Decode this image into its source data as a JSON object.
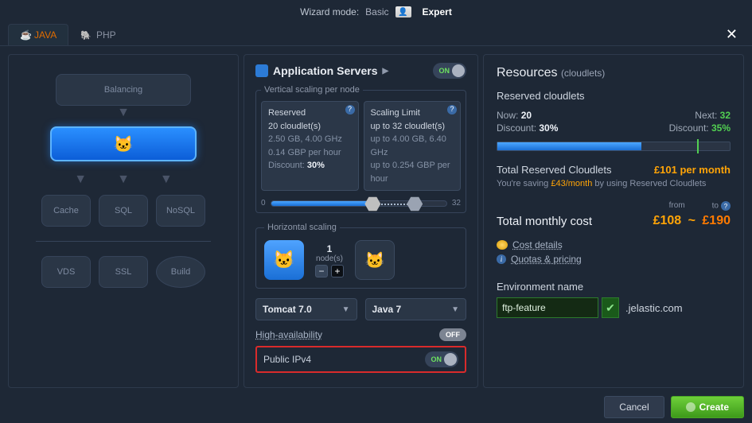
{
  "mode": {
    "label": "Wizard mode:",
    "basic": "Basic",
    "expert": "Expert"
  },
  "tabs": {
    "java": "JAVA",
    "php": "PHP"
  },
  "topology": {
    "balancing": "Balancing",
    "cache": "Cache",
    "sql": "SQL",
    "nosql": "NoSQL",
    "vds": "VDS",
    "ssl": "SSL",
    "build": "Build"
  },
  "appservers": {
    "title": "Application Servers",
    "toggle_icon": "▶",
    "on": "ON",
    "vertical_scaling_legend": "Vertical scaling per node",
    "reserved": {
      "title": "Reserved",
      "subtitle": "20 cloudlet(s)",
      "spec": "2.50 GB, 4.00 GHz",
      "cost": "0.14 GBP per hour",
      "discount_label": "Discount:",
      "discount_val": "30%"
    },
    "limit": {
      "title": "Scaling Limit",
      "subtitle": "up to 32 cloudlet(s)",
      "spec": "up to 4.00 GB, 6.40 GHz",
      "cost": "up to 0.254 GBP per hour"
    },
    "slider_min": "0",
    "slider_max": "32",
    "horizontal_scaling_legend": "Horizontal scaling",
    "node_count": "1",
    "node_label": "node(s)",
    "server_dropdown": "Tomcat 7.0",
    "java_dropdown": "Java 7",
    "ha_label": "High-availability",
    "ha_state": "OFF",
    "ipv4_label": "Public IPv4",
    "ipv4_state": "ON"
  },
  "resources": {
    "title": "Resources",
    "subtitle": "(cloudlets)",
    "reserved_heading": "Reserved cloudlets",
    "now_label": "Now:",
    "now_val": "20",
    "next_label": "Next:",
    "next_val": "32",
    "disc_label": "Discount:",
    "disc_now": "30%",
    "disc_next": "35%",
    "total_reserved_label": "Total Reserved Cloudlets",
    "total_reserved_val": "£101 per month",
    "saving_pre": "You're saving ",
    "saving_amt": "£43/month",
    "saving_post": " by using Reserved Cloudlets",
    "from": "from",
    "to": "to",
    "total_label": "Total monthly cost",
    "total_from": "£108",
    "total_to": "£190",
    "cost_details": "Cost details",
    "quotas": "Quotas & pricing",
    "env_label": "Environment name",
    "env_value": "ftp-feature",
    "env_domain": ".jelastic.com"
  },
  "footer": {
    "cancel": "Cancel",
    "create": "Create"
  }
}
